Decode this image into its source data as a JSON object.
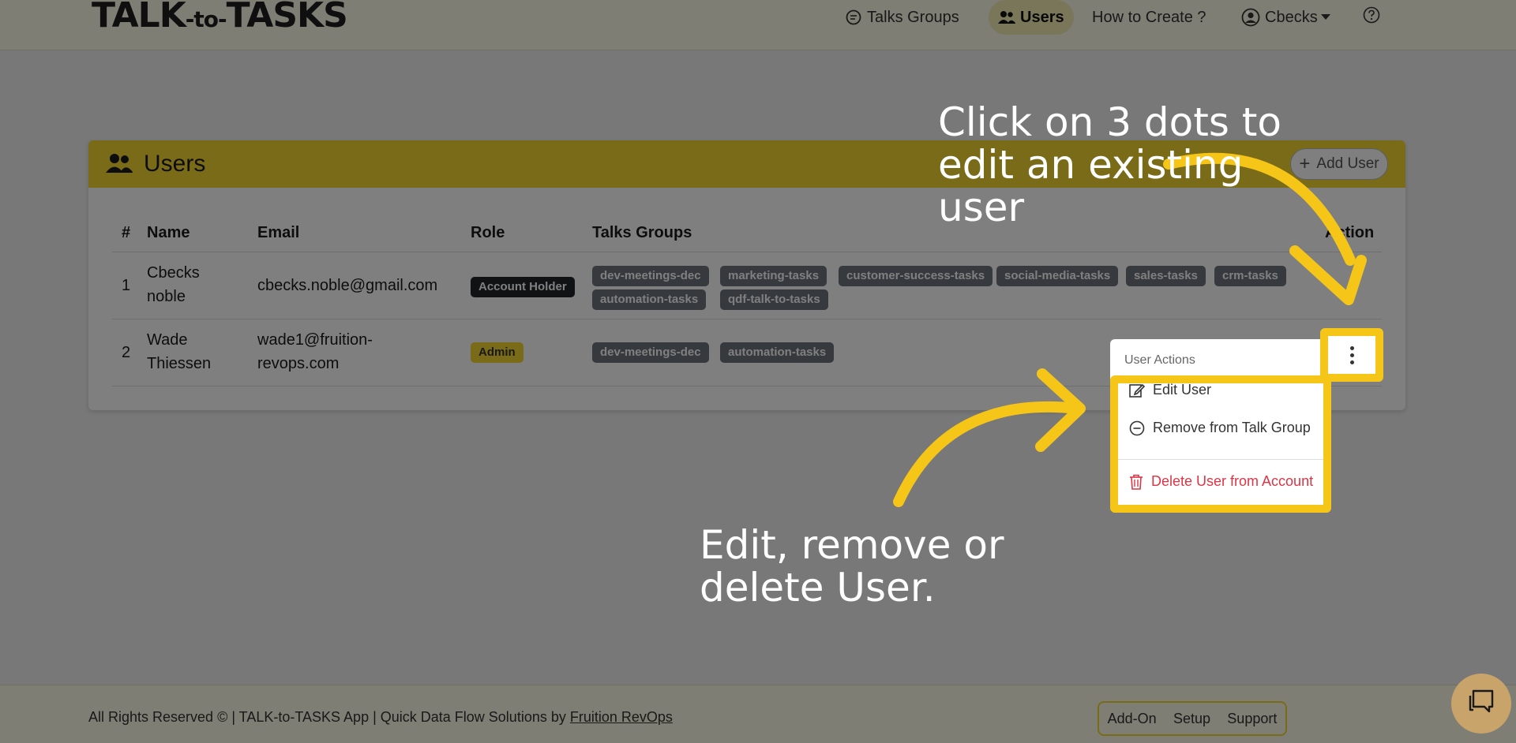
{
  "navbar": {
    "brand_main_a": "TALK",
    "brand_mid": "-to-",
    "brand_main_b": "TASKS",
    "groups": "Talks Groups",
    "users": "Users",
    "how_to": "How to Create ?",
    "account": "Cbecks"
  },
  "card": {
    "title": "Users",
    "add_user": "Add User",
    "columns": {
      "num": "#",
      "name": "Name",
      "email": "Email",
      "role": "Role",
      "groups": "Talks Groups",
      "action": "Action"
    },
    "rows": [
      {
        "num": "1",
        "name_line1": "Cbecks",
        "name_line2": "noble",
        "email_line1": "cbecks.noble@gmail.com",
        "email_line2": "",
        "role": "Account Holder",
        "groups": [
          "dev-meetings-dec",
          "marketing-tasks",
          "customer-success-tasks",
          "social-media-tasks",
          "sales-tasks",
          "crm-tasks",
          "automation-tasks",
          "qdf-talk-to-tasks"
        ]
      },
      {
        "num": "2",
        "name_line1": "Wade",
        "name_line2": "Thiessen",
        "email_line1": "wade1@fruition-",
        "email_line2": "revops.com",
        "role": "Admin",
        "groups": [
          "dev-meetings-dec",
          "automation-tasks"
        ]
      }
    ]
  },
  "dropdown": {
    "header": "User Actions",
    "edit": "Edit User",
    "remove": "Remove from Talk Group",
    "delete": "Delete User from Account"
  },
  "footer": {
    "text": "All Rights Reserved © | TALK-to-TASKS App | Quick Data Flow Solutions by ",
    "link": "Fruition RevOps",
    "addon": "Add-On",
    "setup": "Setup",
    "support": "Support"
  },
  "annotations": {
    "top_line1": "Click on 3 dots to",
    "top_line2": "edit an existing",
    "top_line3": "user",
    "bottom_line1": "Edit, remove or",
    "bottom_line2": "delete User."
  },
  "colors": {
    "accent": "#f5d633",
    "highlight": "#f5c518",
    "danger": "#dc3545"
  }
}
